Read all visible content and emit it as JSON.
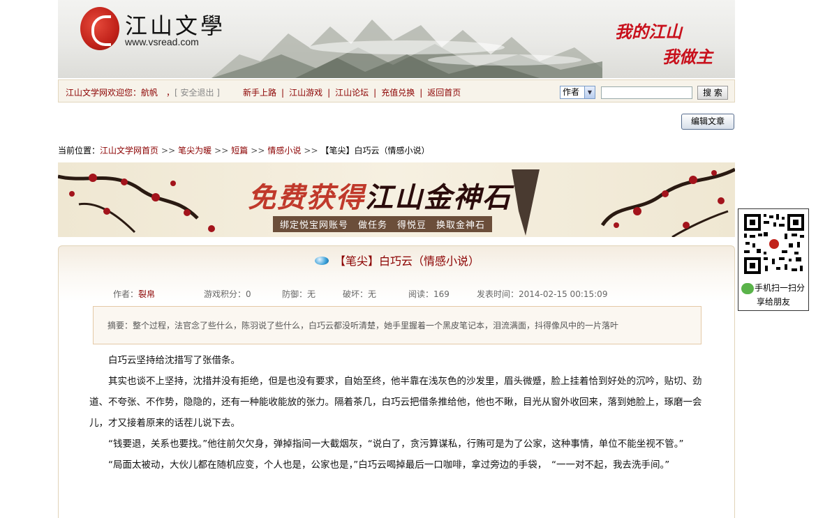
{
  "header": {
    "logo_title": "江山文學",
    "logo_url": "www.vsread.com",
    "slogan_line1": "我的江山",
    "slogan_line2": "我做主"
  },
  "nav": {
    "welcome": "江山文学网欢迎您：航帆　，",
    "logout": "[ 安全退出 ]",
    "links": [
      "新手上路",
      "江山游戏",
      "江山论坛",
      "充值兑换",
      "返回首页"
    ],
    "search_type": "作者",
    "search_value": "",
    "search_button": "搜 索"
  },
  "edit_button": "编辑文章",
  "breadcrumb": {
    "label": "当前位置：",
    "items": [
      "江山文学网首页",
      "笔尖为暖",
      "短篇",
      "情感小说"
    ],
    "separator": ">>",
    "current": "【笔尖】白巧云（情感小说）"
  },
  "banner": {
    "title_part1": "免费获得",
    "title_part2": "江山金神石",
    "subtitle": "绑定悦宝网账号　做任务　得悦豆　换取金神石"
  },
  "article": {
    "title": "【笔尖】白巧云（情感小说）",
    "meta": {
      "author_label": "作者：",
      "author": "裂帛",
      "game_points": "游戏积分：0",
      "defense": "防御：无",
      "damage": "破坏：无",
      "reads": "阅读：169",
      "published": "发表时间：2014-02-15 00:15:09"
    },
    "summary": "摘要：整个过程，法官念了些什么，陈羽说了些什么，白巧云都没听清楚，她手里握着一个黑皮笔记本，泪流满面，抖得像风中的一片落叶",
    "paragraphs": [
      "白巧云坚持给沈措写了张借条。",
      "其实也谈不上坚持，沈措并没有拒绝，但是也没有要求，自始至终，他半靠在浅灰色的沙发里，眉头微蹙，脸上挂着恰到好处的沉吟，贴切、劲道、不夸张、不作势，隐隐的，还有一种能收能放的张力。隔着茶几，白巧云把借条推给他，他也不瞅，目光从窗外收回来，落到她脸上，琢磨一会儿，才又接着原来的话茬儿说下去。",
      "“钱要退，关系也要找。”他往前欠欠身，弹掉指间一大截烟灰，“说白了，贪污算谋私，行贿可是为了公家，这种事情，单位不能坐视不管。”",
      "“局面太被动，大伙儿都在随机应变，个人也是，公家也是，”白巧云喝掉最后一口咖啡，拿过旁边的手袋，　“一一对不起，我去洗手间。”"
    ]
  },
  "qr": {
    "line1": "手机扫一扫分",
    "line2": "享给朋友"
  }
}
